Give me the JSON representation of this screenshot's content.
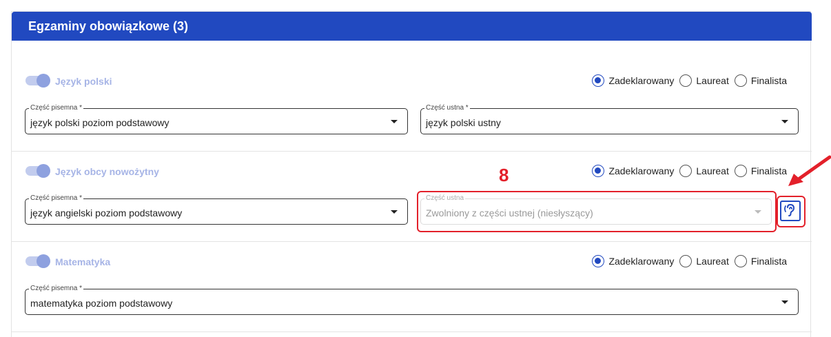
{
  "section": {
    "title": "Egzaminy obowiązkowe (3)"
  },
  "radio_labels": {
    "declared": "Zadeklarowany",
    "laureate": "Laureat",
    "finalist": "Finalista"
  },
  "exams": [
    {
      "subject": "Język polski",
      "written": {
        "label": "Część pisemna *",
        "value": "język polski poziom podstawowy"
      },
      "oral": {
        "label": "Część ustna *",
        "value": "język polski ustny"
      },
      "selected_status": "Zadeklarowany"
    },
    {
      "subject": "Język obcy nowożytny",
      "written": {
        "label": "Część pisemna *",
        "value": "język angielski poziom podstawowy"
      },
      "oral": {
        "label": "Część ustna",
        "value": "Zwolniony z części ustnej (niesłyszący)",
        "disabled": true
      },
      "selected_status": "Zadeklarowany"
    },
    {
      "subject": "Matematyka",
      "written": {
        "label": "Część pisemna *",
        "value": "matematyka poziom podstawowy"
      },
      "selected_status": "Zadeklarowany"
    }
  ],
  "annotation": {
    "marker": "8",
    "color": "#e3202a"
  },
  "colors": {
    "header": "#2149c0",
    "accent": "#2149c0",
    "annotation": "#e3202a"
  },
  "icons": {
    "hearing": "ear-icon"
  }
}
